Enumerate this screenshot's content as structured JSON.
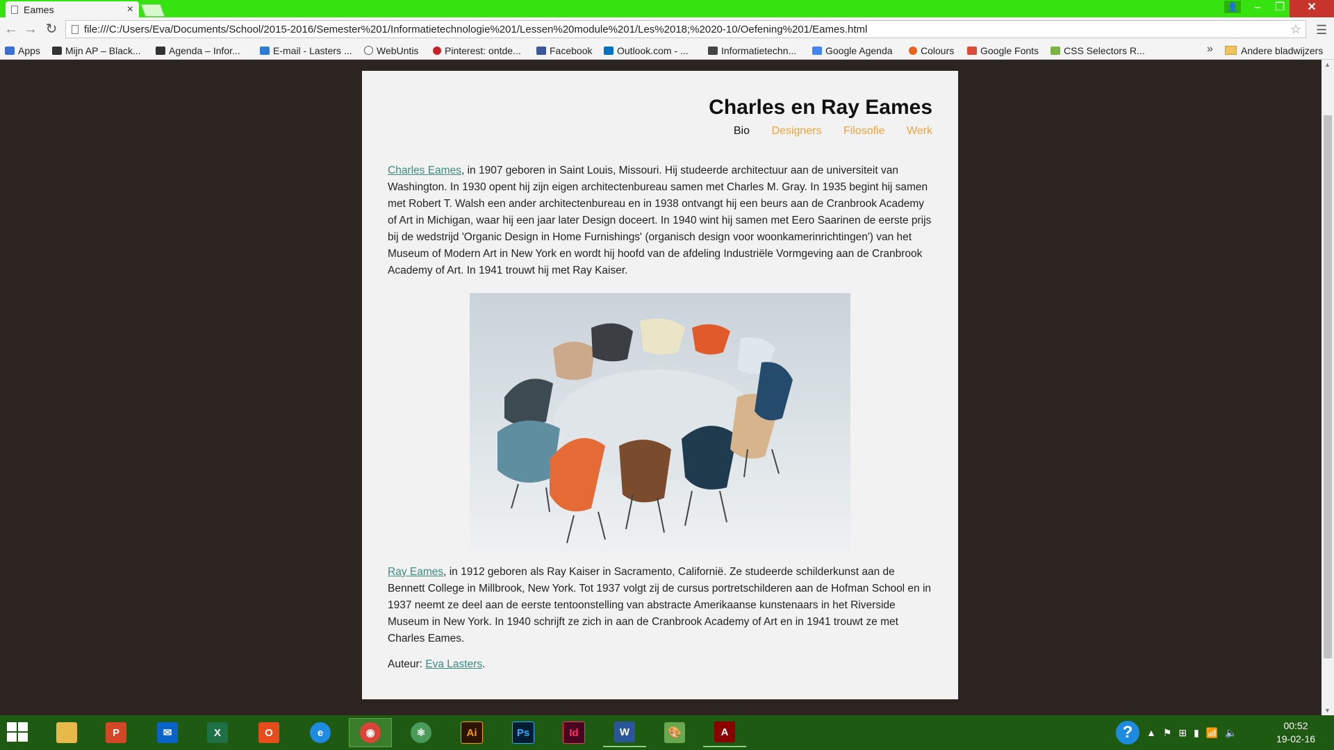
{
  "browser": {
    "tab_title": "Eames",
    "url": "file:///C:/Users/Eva/Documents/School/2015-2016/Semester%201/Informatietechnologie%201/Lessen%20module%201/Les%2018;%2020-10/Oefening%201/Eames.html",
    "bookmarks": [
      {
        "label": "Apps",
        "icon": "apps-grid-icon",
        "color": "#3a6fd8"
      },
      {
        "label": "Mijn AP – Black...",
        "icon": "blackboard-icon",
        "color": "#333333"
      },
      {
        "label": "Agenda – Infor...",
        "icon": "blackboard-icon",
        "color": "#333333"
      },
      {
        "label": "E-mail - Lasters ...",
        "icon": "mail-icon",
        "color": "#2f7bd6"
      },
      {
        "label": "WebUntis",
        "icon": "clock-icon",
        "color": "#555555"
      },
      {
        "label": "Pinterest: ontde...",
        "icon": "pinterest-icon",
        "color": "#cb2027"
      },
      {
        "label": "Facebook",
        "icon": "facebook-icon",
        "color": "#3b5998"
      },
      {
        "label": "Outlook.com - ...",
        "icon": "outlook-icon",
        "color": "#0072c6"
      },
      {
        "label": "Informatietechn...",
        "icon": "cube-icon",
        "color": "#444444"
      },
      {
        "label": "Google Agenda",
        "icon": "calendar-icon",
        "color": "#4285f4"
      },
      {
        "label": "Colours",
        "icon": "colours-icon",
        "color": "#e8641c"
      },
      {
        "label": "Google Fonts",
        "icon": "fonts-icon",
        "color": "#dd4b39"
      },
      {
        "label": "CSS Selectors R...",
        "icon": "css-icon",
        "color": "#7cb342"
      }
    ],
    "more_label": "»",
    "other_bookmarks": "Andere bladwijzers"
  },
  "page": {
    "title": "Charles en Ray Eames",
    "nav": [
      {
        "label": "Bio",
        "active": true
      },
      {
        "label": "Designers",
        "active": false
      },
      {
        "label": "Filosofie",
        "active": false
      },
      {
        "label": "Werk",
        "active": false
      }
    ],
    "p1_link": "Charles Eames",
    "p1_text": ", in 1907 geboren in Saint Louis, Missouri. Hij studeerde architectuur aan de universiteit van Washington. In 1930 opent hij zijn eigen architectenbureau samen met Charles M. Gray. In 1935 begint hij samen met Robert T. Walsh een ander architectenbureau en in 1938 ontvangt hij een beurs aan de Cranbrook Academy of Art in Michigan, waar hij een jaar later Design doceert. In 1940 wint hij samen met Eero Saarinen de eerste prijs bij de wedstrijd 'Organic Design in Home Furnishings' (organisch design voor woonkamerinrichtingen') van het Museum of Modern Art in New York en wordt hij hoofd van de afdeling Industriële Vormgeving aan de Cranbrook Academy of Art. In 1941 trouwt hij met Ray Kaiser.",
    "p2_link": "Ray Eames",
    "p2_text": ", in 1912 geboren als Ray Kaiser in Sacramento, Californië. Ze studeerde schilderkunst aan de Bennett College in Millbrook, New York. Tot 1937 volgt zij de cursus portretschilderen aan de Hofman School en in 1937 neemt ze deel aan de eerste tentoonstelling van abstracte Amerikaanse kunstenaars in het Riverside Museum in New York. In 1940 schrijft ze zich in aan de Cranbrook Academy of Art en in 1941 trouwt ze met Charles Eames.",
    "author_label": "Auteur: ",
    "author_link": "Eva Lasters",
    "author_suffix": ".",
    "colors": {
      "link": "#3c8a7d",
      "nav": "#f0a340",
      "nav_active": "#111111"
    }
  },
  "taskbar": {
    "apps": [
      {
        "name": "file-explorer-icon",
        "label": "",
        "color": "#e5b94a"
      },
      {
        "name": "powerpoint-icon",
        "label": "P",
        "color": "#d24726"
      },
      {
        "name": "mail-app-icon",
        "label": "✉",
        "color": "#0a64c8"
      },
      {
        "name": "excel-icon",
        "label": "X",
        "color": "#1e7145"
      },
      {
        "name": "office-icon",
        "label": "O",
        "color": "#e74c1c"
      },
      {
        "name": "internet-explorer-icon",
        "label": "e",
        "color": "#1e8ae0"
      },
      {
        "name": "chrome-icon",
        "label": "◉",
        "color": "#db4437"
      },
      {
        "name": "atom-icon",
        "label": "⚛",
        "color": "#4a9a5a"
      },
      {
        "name": "illustrator-icon",
        "label": "Ai",
        "color": "#2b1500"
      },
      {
        "name": "photoshop-icon",
        "label": "Ps",
        "color": "#001d34"
      },
      {
        "name": "indesign-icon",
        "label": "Id",
        "color": "#49021f"
      },
      {
        "name": "word-icon",
        "label": "W",
        "color": "#2b579a"
      },
      {
        "name": "paint-icon",
        "label": "🎨",
        "color": "#6aa84f"
      },
      {
        "name": "acrobat-icon",
        "label": "A",
        "color": "#8b0000"
      }
    ],
    "time": "00:52",
    "date": "19-02-16"
  }
}
